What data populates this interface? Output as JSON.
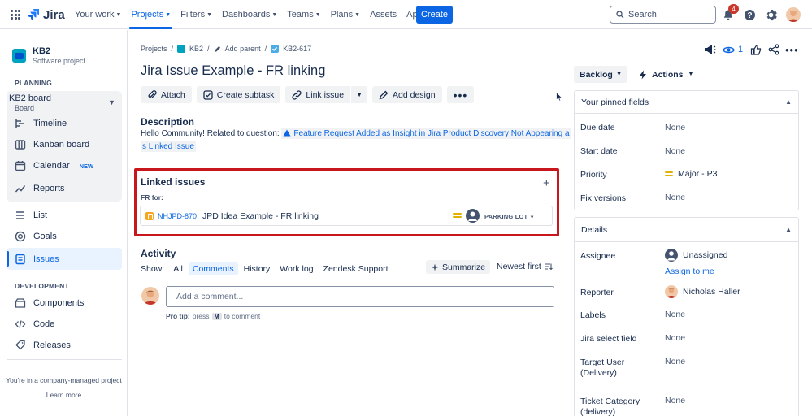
{
  "app": {
    "name": "Jira"
  },
  "topnav": {
    "items": [
      {
        "label": "Your work"
      },
      {
        "label": "Projects",
        "active": true
      },
      {
        "label": "Filters"
      },
      {
        "label": "Dashboards"
      },
      {
        "label": "Teams"
      },
      {
        "label": "Plans"
      },
      {
        "label": "Assets"
      },
      {
        "label": "Apps"
      }
    ],
    "create_label": "Create",
    "search_placeholder": "Search",
    "notification_count": "4",
    "icons": [
      "app-switcher-icon",
      "bell-icon",
      "help-icon",
      "gear-icon",
      "avatar"
    ]
  },
  "sidebar": {
    "project_name": "KB2",
    "project_type": "Software project",
    "planning_label": "PLANNING",
    "board_name": "KB2 board",
    "board_type": "Board",
    "planning_items": [
      {
        "label": "Timeline",
        "icon": "timeline-icon"
      },
      {
        "label": "Kanban board",
        "icon": "kanban-icon"
      },
      {
        "label": "Calendar",
        "icon": "calendar-icon",
        "badge": "NEW"
      },
      {
        "label": "Reports",
        "icon": "reports-icon"
      }
    ],
    "items": [
      {
        "label": "List",
        "icon": "list-icon"
      },
      {
        "label": "Goals",
        "icon": "goals-icon"
      },
      {
        "label": "Issues",
        "icon": "issues-icon",
        "active": true
      }
    ],
    "development_label": "DEVELOPMENT",
    "dev_items": [
      {
        "label": "Components",
        "icon": "components-icon"
      },
      {
        "label": "Code",
        "icon": "code-icon"
      },
      {
        "label": "Releases",
        "icon": "releases-icon"
      }
    ],
    "footer_text": "You're in a company-managed project",
    "footer_link": "Learn more"
  },
  "breadcrumb": {
    "projects": "Projects",
    "project": "KB2",
    "add_parent": "Add parent",
    "issue_key": "KB2-617"
  },
  "issue": {
    "title": "Jira Issue Example - FR linking",
    "toolbar": {
      "attach": "Attach",
      "create_subtask": "Create subtask",
      "link_issue": "Link issue",
      "add_design": "Add design"
    },
    "description": {
      "heading": "Description",
      "text": "Hello Community! Related to question: ",
      "link_part1": "Feature Request Added as Insight in Jira Product Discovery Not Appearing a",
      "link_part2": "s Linked Issue"
    },
    "linked": {
      "heading": "Linked issues",
      "relation": "FR for:",
      "item_key": "NHJPD-870",
      "item_summary": "JPD Idea Example - FR linking",
      "item_status": "PARKING LOT",
      "priority_color": "#e2b203"
    },
    "activity": {
      "heading": "Activity",
      "show_label": "Show:",
      "filters": [
        "All",
        "Comments",
        "History",
        "Work log",
        "Zendesk Support"
      ],
      "selected_filter": "Comments",
      "summarize": "Summarize",
      "sort": "Newest first",
      "comment_placeholder": "Add a comment...",
      "protip_label": "Pro tip:",
      "protip_press": "press",
      "protip_key": "M",
      "protip_suffix": "to comment"
    }
  },
  "right": {
    "status": "Backlog",
    "actions": "Actions",
    "watch_count": "1",
    "pinned_heading": "Your pinned fields",
    "pinned_fields": [
      {
        "label": "Due date",
        "value": "None"
      },
      {
        "label": "Start date",
        "value": "None"
      },
      {
        "label": "Priority",
        "value": "Major - P3"
      },
      {
        "label": "Fix versions",
        "value": "None"
      }
    ],
    "details_heading": "Details",
    "details": {
      "assignee_label": "Assignee",
      "assignee_value": "Unassigned",
      "assign_to_me": "Assign to me",
      "reporter_label": "Reporter",
      "reporter_value": "Nicholas Haller",
      "labels_label": "Labels",
      "labels_value": "None",
      "jira_select_label": "Jira select field",
      "jira_select_value": "None",
      "target_user_label_1": "Target User",
      "target_user_label_2": "(Delivery)",
      "target_user_value": "None",
      "ticket_cat_label_1": "Ticket Category",
      "ticket_cat_label_2": "(delivery)",
      "ticket_cat_value": "None"
    }
  },
  "colors": {
    "brand": "#0c66e4",
    "highlight_border": "#c8161d",
    "notification": "#c9372c"
  }
}
